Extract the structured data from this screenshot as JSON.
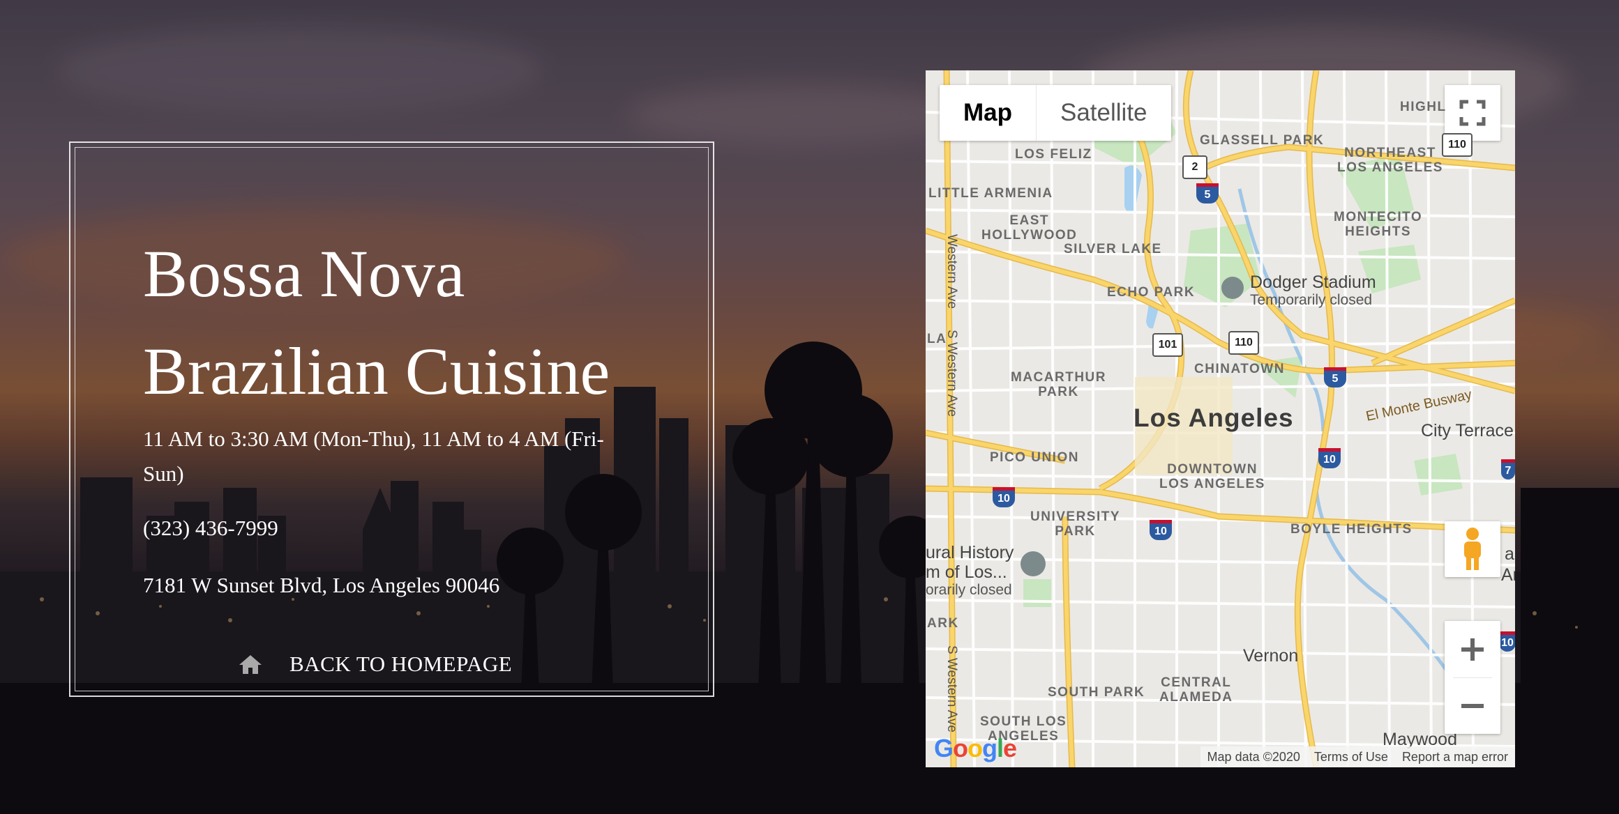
{
  "restaurant": {
    "title_line1": "Bossa Nova",
    "title_line2": "Brazilian Cuisine",
    "hours_line1": "11 AM to 3:30 AM (Mon-Thu), 11 AM to 4 AM (Fri-",
    "hours_line2": "Sun)",
    "phone": "(323) 436-7999",
    "address": "7181 W Sunset Blvd, Los Angeles 90046",
    "back_label": "BACK TO HOMEPAGE",
    "back_icon": "home-icon"
  },
  "map": {
    "type_map": "Map",
    "type_satellite": "Satellite",
    "city": "Los Angeles",
    "neighborhoods": {
      "los_feliz": "LOS FELIZ",
      "glassell_park": "GLASSELL PARK",
      "northeast_la_1": "NORTHEAST",
      "northeast_la_2": "LOS ANGELES",
      "little_armenia": "LITTLE ARMENIA",
      "east_hollywood_1": "EAST",
      "east_hollywood_2": "HOLLYWOOD",
      "silver_lake": "SILVER LAKE",
      "montecito_1": "MONTECITO",
      "montecito_2": "HEIGHTS",
      "echo_park": "ECHO PARK",
      "chinatown": "CHINATOWN",
      "macarthur_1": "MACARTHUR",
      "macarthur_2": "PARK",
      "pico_union": "PICO UNION",
      "downtown_1": "DOWNTOWN",
      "downtown_2": "LOS ANGELES",
      "university_1": "UNIVERSITY",
      "university_2": "PARK",
      "boyle_heights": "BOYLE HEIGHTS",
      "south_park": "SOUTH PARK",
      "central_1": "CENTRAL",
      "central_2": "ALAMEDA",
      "south_la_1": "SOUTH LOS",
      "south_la_2": "ANGELES",
      "highl": "HIGHL",
      "la_edge": "LA",
      "ark_edge": "ARK"
    },
    "places": {
      "dodger_stadium": "Dodger Stadium",
      "dodger_status": "Temporarily closed",
      "museum_1": "ural History",
      "museum_2": "m of Los...",
      "museum_3": "orarily closed",
      "city_terrace": "City Terrace",
      "vernon": "Vernon",
      "maywood": "Maywood",
      "el_monte_busway": "El Monte Busway",
      "western_ave": "Western Ave",
      "s_western_ave": "S Western Ave",
      "s_western_ave_2": "S Western Ave",
      "edge_a": "a",
      "edge_an": "An"
    },
    "shields": {
      "r2": "2",
      "i5a": "5",
      "r101": "101",
      "r110": "110",
      "i5b": "5",
      "i10a": "10",
      "i10b": "10",
      "i10c": "10",
      "i10d": "10",
      "r110b": "110",
      "i7": "7"
    },
    "attribution": {
      "data": "Map data ©2020",
      "terms": "Terms of Use",
      "report": "Report a map error"
    },
    "logo": "Google"
  },
  "colors": {
    "road_yellow": "#f9d56b",
    "road_outline": "#e6b94a",
    "park_green": "#c8e6c0",
    "water_blue": "#a8d0f0"
  }
}
